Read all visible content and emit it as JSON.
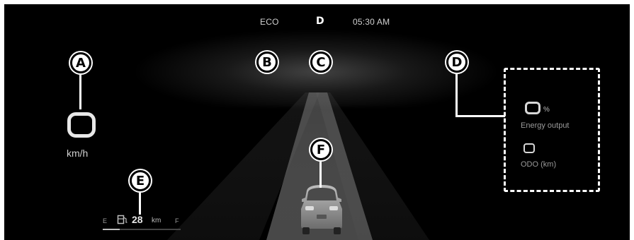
{
  "status_bar": {
    "drive_mode": "ECO",
    "gear": "D",
    "clock": "05:30 AM"
  },
  "speed": {
    "unit": "km/h"
  },
  "info_panel": {
    "energy_unit": "%",
    "energy_label": "Energy output",
    "odo_label": "ODO (km)"
  },
  "range": {
    "empty_label": "E",
    "full_label": "F",
    "value": "28",
    "unit": "km",
    "fill_fraction": 0.22
  },
  "callouts": {
    "a": "A",
    "b": "B",
    "c": "C",
    "d": "D",
    "e": "E",
    "f": "F"
  },
  "icons": [
    "fuel-gauge-icon",
    "car-icon"
  ],
  "colors": {
    "background": "#000000",
    "primary_text": "#e6e6e6",
    "secondary_text": "#9a9a9a",
    "callout": "#ffffff"
  }
}
